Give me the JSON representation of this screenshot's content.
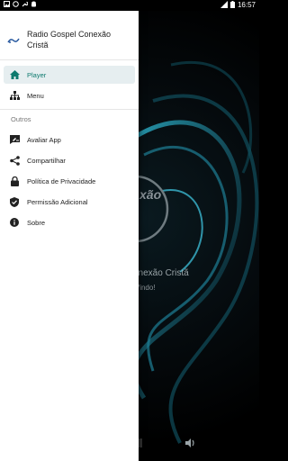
{
  "status_bar": {
    "time": "16:57"
  },
  "drawer": {
    "app_title": "Radio Gospel Conexão Cristã",
    "items_primary": [
      {
        "label": "Player",
        "icon": "home-icon",
        "active": true
      },
      {
        "label": "Menu",
        "icon": "sitemap-icon",
        "active": false
      }
    ],
    "section_label": "Outros",
    "items_other": [
      {
        "label": "Avaliar App",
        "icon": "rate-review-icon"
      },
      {
        "label": "Compartilhar",
        "icon": "share-icon"
      },
      {
        "label": "Política de Privacidade",
        "icon": "lock-icon"
      },
      {
        "label": "Permissão Adicional",
        "icon": "verified-shield-icon"
      },
      {
        "label": "Sobre",
        "icon": "info-icon"
      }
    ]
  },
  "player": {
    "station_name_partial": "onexão Cristã",
    "subtitle_partial": "Vindo!",
    "logo_text_partial": "xão"
  },
  "colors": {
    "accent": "#0d7a6e",
    "active_bg": "#e6eef0"
  }
}
